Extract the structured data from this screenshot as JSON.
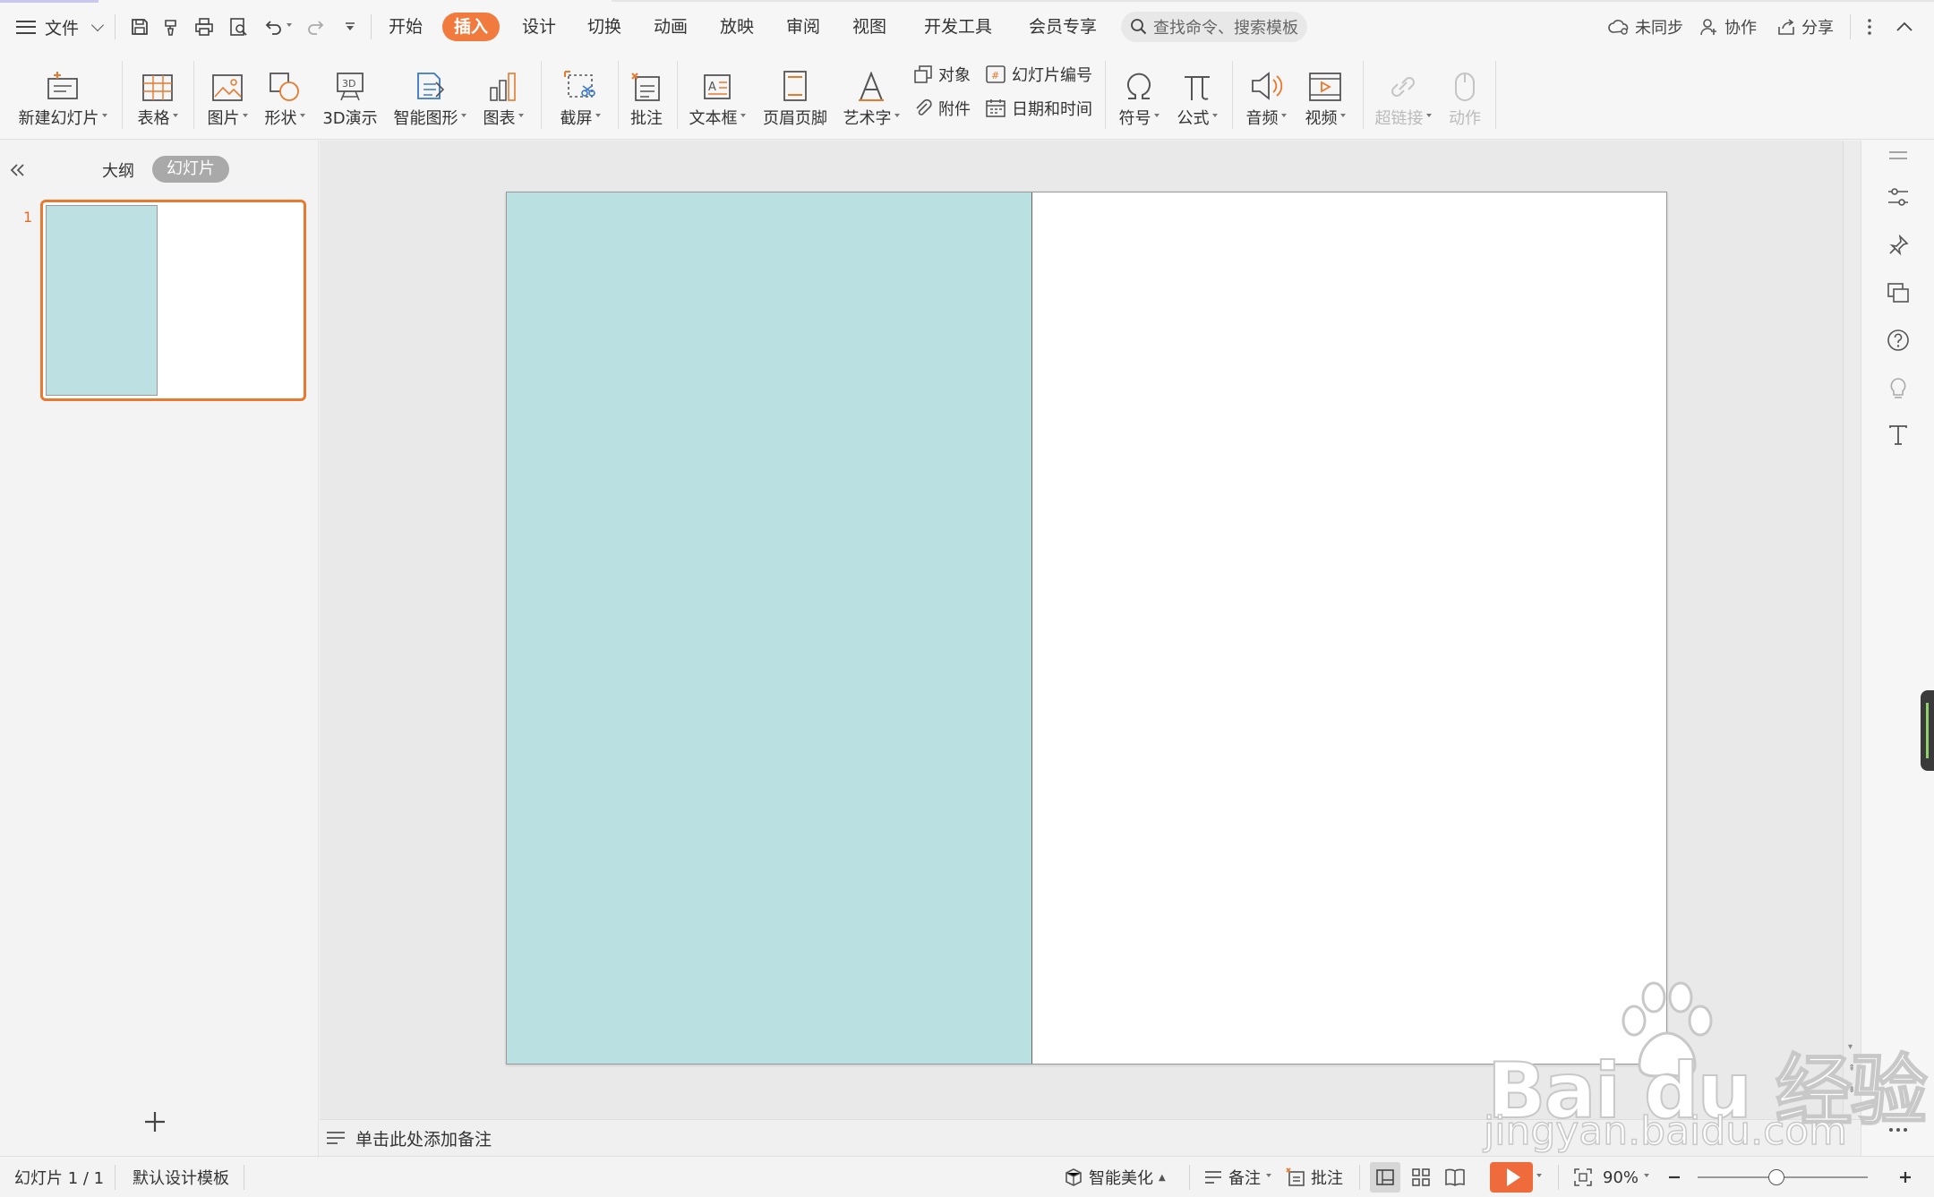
{
  "menubar": {
    "file_label": "文件",
    "tabs": [
      "开始",
      "插入",
      "设计",
      "切换",
      "动画",
      "放映",
      "审阅",
      "视图",
      "开发工具",
      "会员专享"
    ],
    "active_tab": "插入",
    "search_placeholder": "查找命令、搜索模板",
    "sync_label": "未同步",
    "collab_label": "协作",
    "share_label": "分享"
  },
  "ribbon": {
    "new_slide": "新建幻灯片",
    "table": "表格",
    "picture": "图片",
    "shape": "形状",
    "demo3d": "3D演示",
    "smartart": "智能图形",
    "chart": "图表",
    "screenshot": "截屏",
    "comment": "批注",
    "textbox": "文本框",
    "header_footer": "页眉页脚",
    "wordart": "艺术字",
    "object": "对象",
    "slide_number": "幻灯片编号",
    "attachment": "附件",
    "date_time": "日期和时间",
    "symbol": "符号",
    "formula": "公式",
    "audio": "音频",
    "video": "视频",
    "hyperlink": "超链接",
    "action": "动作"
  },
  "left_panel": {
    "outline_tab": "大纲",
    "slides_tab": "幻灯片",
    "active_tab": "幻灯片",
    "slide_number": "1"
  },
  "slide": {
    "left_panel_color": "#bbe0e2"
  },
  "notes": {
    "placeholder": "单击此处添加备注"
  },
  "status": {
    "slide_counter": "幻灯片 1 / 1",
    "template": "默认设计模板",
    "beautify": "智能美化",
    "notes": "备注",
    "comments": "批注",
    "zoom": "90%"
  },
  "watermark": {
    "brand": "Bai du 经验",
    "url": "jingyan.baidu.com"
  },
  "colors": {
    "accent": "#f17a3e",
    "slide_fill": "#bbe0e2"
  }
}
